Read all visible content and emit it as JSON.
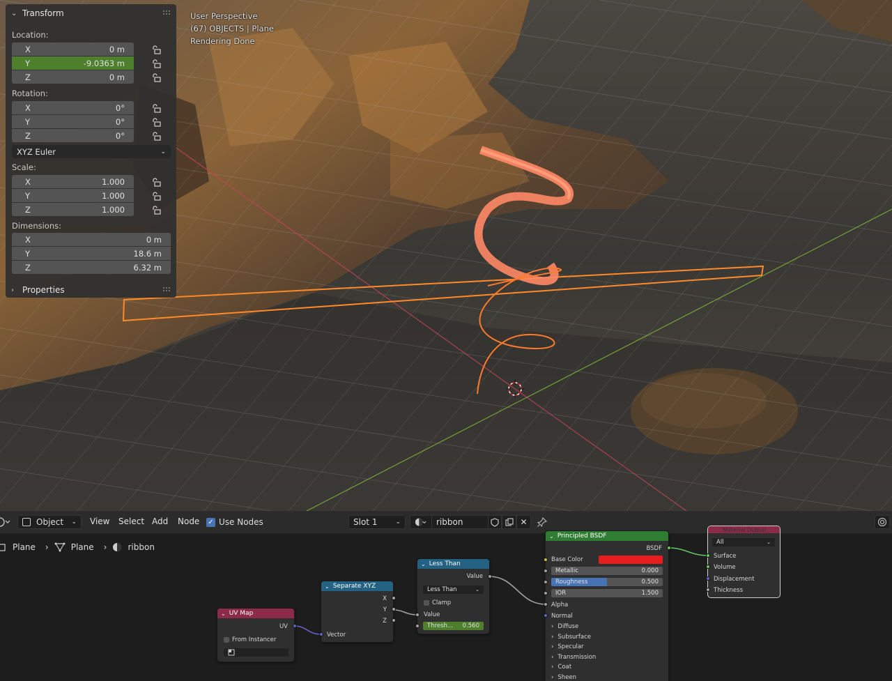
{
  "viewport": {
    "overlay": [
      "User Perspective",
      "(67) OBJECTS | Plane",
      "Rendering Done"
    ]
  },
  "npanel": {
    "transform_title": "Transform",
    "location_label": "Location:",
    "location": [
      {
        "axis": "X",
        "value": "0 m"
      },
      {
        "axis": "Y",
        "value": "-9.0363 m"
      },
      {
        "axis": "Z",
        "value": "0 m"
      }
    ],
    "rotation_label": "Rotation:",
    "rotation": [
      {
        "axis": "X",
        "value": "0°"
      },
      {
        "axis": "Y",
        "value": "0°"
      },
      {
        "axis": "Z",
        "value": "0°"
      }
    ],
    "rotation_mode": "XYZ Euler",
    "scale_label": "Scale:",
    "scale": [
      {
        "axis": "X",
        "value": "1.000"
      },
      {
        "axis": "Y",
        "value": "1.000"
      },
      {
        "axis": "Z",
        "value": "1.000"
      }
    ],
    "dimensions_label": "Dimensions:",
    "dimensions": [
      {
        "axis": "X",
        "value": "0 m"
      },
      {
        "axis": "Y",
        "value": "18.6 m"
      },
      {
        "axis": "Z",
        "value": "6.32 m"
      }
    ],
    "properties_title": "Properties"
  },
  "node_header": {
    "object_mode": "Object",
    "menus": [
      "View",
      "Select",
      "Add",
      "Node"
    ],
    "use_nodes": "Use Nodes",
    "slot": "Slot 1",
    "material": "ribbon"
  },
  "breadcrumbs": [
    "Plane",
    "Plane",
    "ribbon"
  ],
  "nodes": {
    "uvmap": {
      "title": "UV Map",
      "out": "UV",
      "from_instancer": "From Instancer"
    },
    "separate": {
      "title": "Separate XYZ",
      "x": "X",
      "y": "Y",
      "z": "Z",
      "in": "Vector"
    },
    "lessthan": {
      "title": "Less Than",
      "out": "Value",
      "op": "Less Than",
      "clamp": "Clamp",
      "in": "Value",
      "thresh_label": "Thresh...",
      "thresh_value": "0.560"
    },
    "bsdf": {
      "title": "Principled BSDF",
      "out": "BSDF",
      "base_color": "Base Color",
      "metallic": "Metallic",
      "metallic_value": "0.000",
      "roughness": "Roughness",
      "roughness_value": "0.500",
      "ior": "IOR",
      "ior_value": "1.500",
      "alpha": "Alpha",
      "normal": "Normal",
      "panels": [
        "Diffuse",
        "Subsurface",
        "Specular",
        "Transmission",
        "Coat",
        "Sheen"
      ]
    },
    "output": {
      "title": "Material Output",
      "target": "All",
      "surface": "Surface",
      "volume": "Volume",
      "displacement": "Displacement",
      "thickness": "Thickness"
    }
  },
  "colors": {
    "accent_green": "#4d7f2c",
    "selected_orange": "#ff8a2a",
    "base_color": "#e81e1e",
    "bsdf_header": "#2f7d32",
    "uv_header": "#8c2a4a",
    "blue_header": "#246283"
  }
}
